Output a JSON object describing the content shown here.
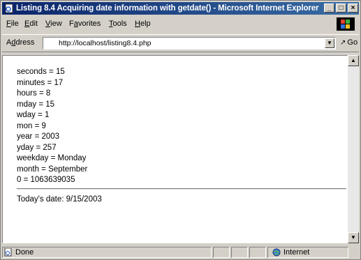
{
  "window": {
    "title": "Listing 8.4 Acquiring date information with getdate() - Microsoft Internet Explorer",
    "controls": {
      "minimize": "_",
      "maximize": "□",
      "close": "×"
    }
  },
  "menu": [
    {
      "key": "F",
      "rest": "ile"
    },
    {
      "key": "E",
      "rest": "dit"
    },
    {
      "key": "V",
      "rest": "iew"
    },
    {
      "key": "a",
      "pre": "F",
      "rest": "vorites"
    },
    {
      "key": "T",
      "rest": "ools"
    },
    {
      "key": "H",
      "rest": "elp"
    }
  ],
  "address": {
    "label_pre": "A",
    "label_key": "d",
    "label_rest": "dress",
    "url": "http://localhost/listing8.4.php",
    "go_label": "Go"
  },
  "content": {
    "lines": [
      "seconds = 15",
      "minutes = 17",
      "hours = 8",
      "mday = 15",
      "wday = 1",
      "mon = 9",
      "year = 2003",
      "yday = 257",
      "weekday = Monday",
      "month = September",
      "0 = 1063639035"
    ],
    "todays_date": "Today's date: 9/15/2003"
  },
  "status": {
    "text": "Done",
    "zone": "Internet"
  },
  "icons": {
    "app": "ie-page-icon",
    "throbber": "windows-logo-icon",
    "status": "page-done-icon",
    "zone": "globe-icon"
  }
}
